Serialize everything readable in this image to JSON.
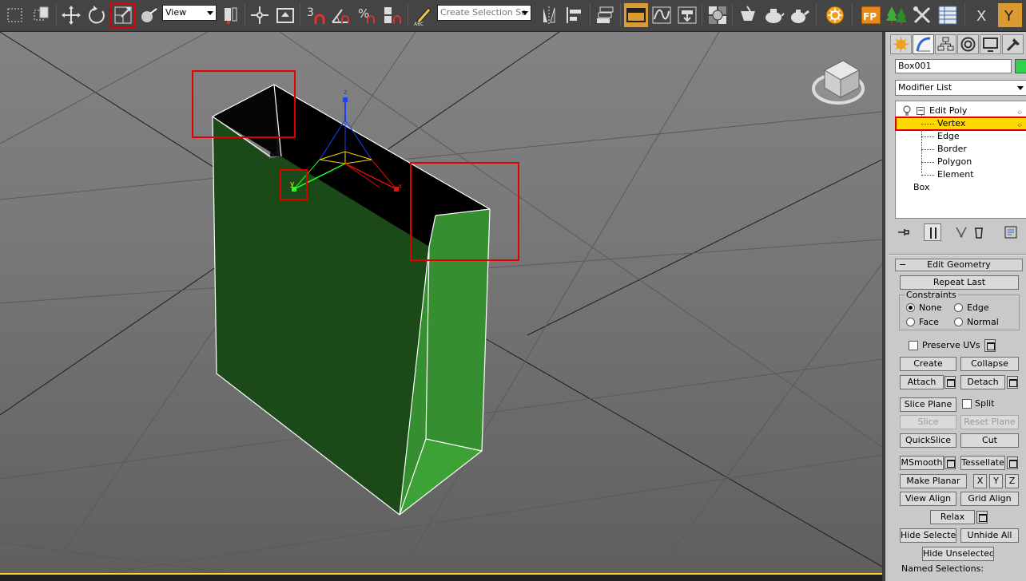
{
  "toolbar": {
    "view_combo": "View",
    "selection_set_placeholder": "Create Selection Se",
    "snap_number": "3",
    "percent_symbol": "%",
    "abc_label": "ABC",
    "fp_label": "FP",
    "axis_x": "X",
    "axis_y": "Y"
  },
  "viewport": {
    "gizmo_x": "x",
    "gizmo_y": "y",
    "gizmo_z": "z",
    "colors": {
      "box_front": "#1b4a18",
      "box_side": "#358e2f",
      "box_inner": "#000000",
      "highlight": "#e00000"
    }
  },
  "panel": {
    "object_name": "Box001",
    "object_color": "#2fd24b",
    "modifier_list": "Modifier List",
    "stack": {
      "edit_poly": "Edit Poly",
      "subobjects": [
        "Vertex",
        "Edge",
        "Border",
        "Polygon",
        "Element"
      ],
      "base": "Box"
    },
    "edit_geometry": {
      "title": "Edit Geometry",
      "repeat_last": "Repeat Last",
      "constraints": "Constraints",
      "radios": [
        "None",
        "Edge",
        "Face",
        "Normal"
      ],
      "preserve_uvs": "Preserve UVs",
      "create": "Create",
      "collapse": "Collapse",
      "attach": "Attach",
      "detach": "Detach",
      "slice_plane": "Slice Plane",
      "split": "Split",
      "slice": "Slice",
      "reset_plane": "Reset Plane",
      "quickslice": "QuickSlice",
      "cut": "Cut",
      "msmooth": "MSmooth",
      "tessellate": "Tessellate",
      "make_planar": "Make Planar",
      "x": "X",
      "y": "Y",
      "z": "Z",
      "view_align": "View Align",
      "grid_align": "Grid Align",
      "relax": "Relax",
      "hide_selected": "Hide Selected",
      "unhide_all": "Unhide All",
      "hide_unselected": "Hide Unselected",
      "named_selections": "Named Selections:"
    }
  }
}
